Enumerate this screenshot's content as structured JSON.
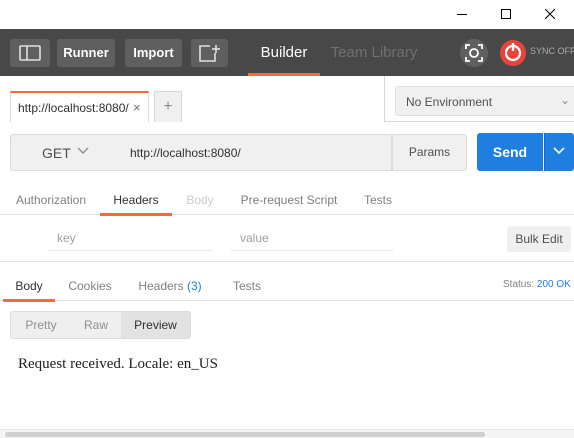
{
  "toolbar": {
    "runner_label": "Runner",
    "import_label": "Import",
    "builder_label": "Builder",
    "team_library_label": "Team Library",
    "sync_label": "SYNC OFF",
    "icons": [
      "sidebar-toggle-icon",
      "new-window-icon",
      "interceptor-icon",
      "sync-icon"
    ]
  },
  "tabs": {
    "request_tab_label": "http://localhost:8080/",
    "close_glyph": "×",
    "add_glyph": "+"
  },
  "environment": {
    "selected": "No Environment",
    "chevron": "⌄"
  },
  "request": {
    "method": "GET",
    "url": "http://localhost:8080/",
    "params_label": "Params",
    "send_label": "Send"
  },
  "request_tabs": [
    {
      "label": "Authorization",
      "state": "normal"
    },
    {
      "label": "Headers",
      "state": "active"
    },
    {
      "label": "Body",
      "state": "disabled"
    },
    {
      "label": "Pre-request Script",
      "state": "normal"
    },
    {
      "label": "Tests",
      "state": "normal"
    }
  ],
  "headers_editor": {
    "key_placeholder": "key",
    "value_placeholder": "value",
    "bulk_edit_label": "Bulk Edit"
  },
  "response_tabs": {
    "body": "Body",
    "cookies": "Cookies",
    "headers": "Headers",
    "headers_count": "(3)",
    "tests": "Tests"
  },
  "status": {
    "label": "Status:",
    "value": "200 OK"
  },
  "view_modes": {
    "pretty": "Pretty",
    "raw": "Raw",
    "preview": "Preview",
    "active": "Preview"
  },
  "response_body": "Request received. Locale: en_US",
  "colors": {
    "accent": "#f26b3a",
    "send_blue": "#1f7ee0",
    "toolbar_bg": "#484848"
  }
}
